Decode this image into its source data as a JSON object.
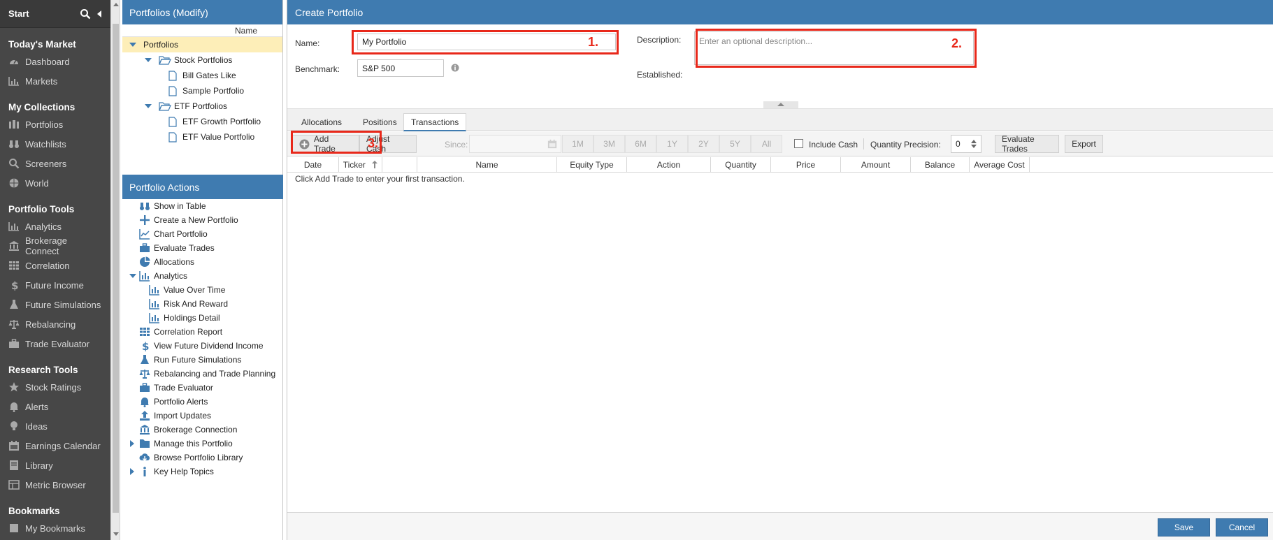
{
  "nav": {
    "start_label": "Start",
    "sections": [
      {
        "title": "Today's Market",
        "items": [
          {
            "label": "Dashboard",
            "icon": "gauge-icon"
          },
          {
            "label": "Markets",
            "icon": "chart-icon"
          }
        ]
      },
      {
        "title": "My Collections",
        "items": [
          {
            "label": "Portfolios",
            "icon": "portfolio-icon"
          },
          {
            "label": "Watchlists",
            "icon": "binoculars-icon"
          },
          {
            "label": "Screeners",
            "icon": "search-icon"
          },
          {
            "label": "World",
            "icon": "globe-icon"
          }
        ]
      },
      {
        "title": "Portfolio Tools",
        "items": [
          {
            "label": "Analytics",
            "icon": "bar-chart-icon"
          },
          {
            "label": "Brokerage Connect",
            "icon": "bank-icon"
          },
          {
            "label": "Correlation",
            "icon": "grid-icon"
          },
          {
            "label": "Future Income",
            "icon": "dollar-icon"
          },
          {
            "label": "Future Simulations",
            "icon": "flask-icon"
          },
          {
            "label": "Rebalancing",
            "icon": "scale-icon"
          },
          {
            "label": "Trade Evaluator",
            "icon": "briefcase-icon"
          }
        ]
      },
      {
        "title": "Research Tools",
        "items": [
          {
            "label": "Stock Ratings",
            "icon": "star-icon"
          },
          {
            "label": "Alerts",
            "icon": "bell-icon"
          },
          {
            "label": "Ideas",
            "icon": "bulb-icon"
          },
          {
            "label": "Earnings Calendar",
            "icon": "calendar-icon"
          },
          {
            "label": "Library",
            "icon": "book-icon"
          },
          {
            "label": "Metric Browser",
            "icon": "table-icon"
          }
        ]
      },
      {
        "title": "Bookmarks",
        "items": [
          {
            "label": "My Bookmarks",
            "icon": "bookmark-icon"
          }
        ]
      }
    ]
  },
  "portfolios_panel": {
    "title": "Portfolios (Modify)",
    "column_header": "Name",
    "root": "Portfolios",
    "stock_folder": "Stock Portfolios",
    "stock_items": [
      "Bill Gates Like",
      "Sample Portfolio"
    ],
    "etf_folder": "ETF Portfolios",
    "etf_items": [
      "ETF Growth Portfolio",
      "ETF Value Portfolio"
    ]
  },
  "actions_panel": {
    "title": "Portfolio Actions",
    "items": [
      "Show in Table",
      "Create a New Portfolio",
      "Chart Portfolio",
      "Evaluate Trades",
      "Allocations",
      "Analytics",
      "Value Over Time",
      "Risk And Reward",
      "Holdings Detail",
      "Correlation Report",
      "View Future Dividend Income",
      "Run Future Simulations",
      "Rebalancing and Trade Planning",
      "Trade Evaluator",
      "Portfolio Alerts",
      "Import Updates",
      "Brokerage Connection",
      "Manage this Portfolio",
      "Browse Portfolio Library",
      "Key Help Topics"
    ]
  },
  "main": {
    "title": "Create Portfolio",
    "name_label": "Name:",
    "name_value": "My Portfolio",
    "benchmark_label": "Benchmark:",
    "benchmark_value": "S&P 500",
    "description_label": "Description:",
    "description_placeholder": "Enter an optional description...",
    "established_label": "Established:",
    "annotations": [
      "1.",
      "2.",
      "3."
    ],
    "tabs": [
      "Allocations",
      "Positions",
      "Transactions"
    ],
    "active_tab": "Transactions",
    "toolbar": {
      "add_trade": "Add Trade",
      "adjust_cash": "Adjust Cash",
      "since_label": "Since:",
      "ranges": [
        "1M",
        "3M",
        "6M",
        "1Y",
        "2Y",
        "5Y",
        "All"
      ],
      "include_cash": "Include Cash",
      "quantity_precision_label": "Quantity Precision:",
      "quantity_precision_value": "0",
      "evaluate_trades": "Evaluate Trades",
      "export": "Export"
    },
    "columns": [
      "Date",
      "Ticker",
      "Name",
      "Equity Type",
      "Action",
      "Quantity",
      "Price",
      "Amount",
      "Balance",
      "Average Cost"
    ],
    "empty_message": "Click Add Trade to enter your first transaction.",
    "save_label": "Save",
    "cancel_label": "Cancel"
  },
  "colors": {
    "accent": "#3f7bb0",
    "annotation": "#e8281a",
    "nav_bg": "#474747",
    "selection": "#fdeeb8"
  }
}
